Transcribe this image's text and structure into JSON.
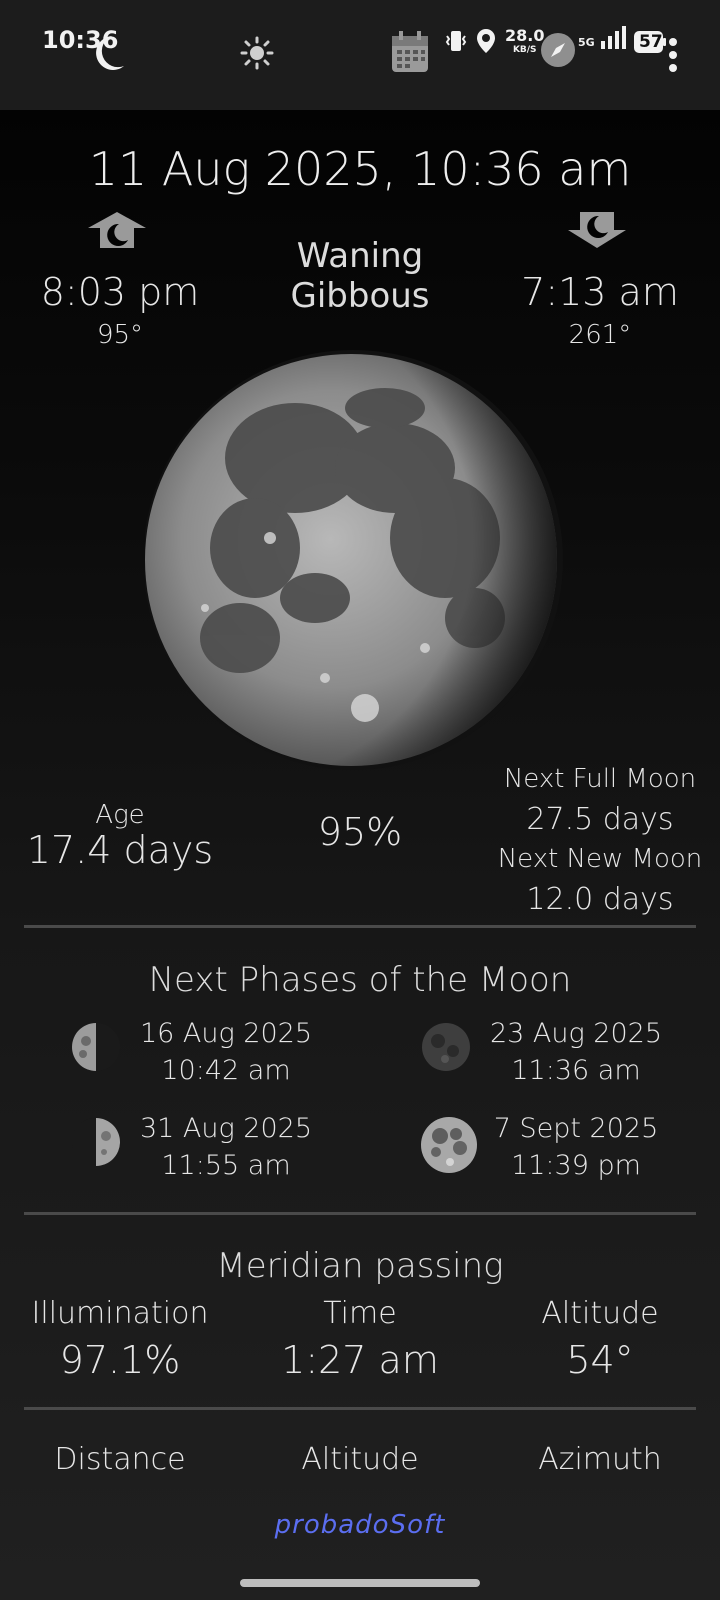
{
  "status_bar": {
    "time": "10:36",
    "speed_value": "28.0",
    "speed_unit": "KB/S",
    "network": "5G",
    "battery": "57",
    "icons": [
      "moon-icon",
      "sun-icon",
      "calendar-icon",
      "vibrate-icon",
      "location-icon",
      "compass-icon",
      "signal-icon",
      "battery-icon",
      "more-icon"
    ]
  },
  "header": {
    "datetime": "11 Aug 2025, 10:36 am",
    "moonrise_time": "8:03 pm",
    "moonrise_azimuth": "95°",
    "moonset_time": "7:13 am",
    "moonset_azimuth": "261°",
    "phase_line1": "Waning",
    "phase_line2": "Gibbous"
  },
  "stats": {
    "age_label": "Age",
    "age_value": "17.4 days",
    "illumination": "95%",
    "next_full_label": "Next Full Moon",
    "next_full_value": "27.5 days",
    "next_new_label": "Next New Moon",
    "next_new_value": "12.0 days"
  },
  "next_phases": {
    "title": "Next Phases of the Moon",
    "items": [
      {
        "date": "16 Aug 2025",
        "time": "10:42 am",
        "phase": "last-quarter"
      },
      {
        "date": "23 Aug 2025",
        "time": "11:36 am",
        "phase": "new"
      },
      {
        "date": "31 Aug 2025",
        "time": "11:55 am",
        "phase": "first-quarter"
      },
      {
        "date": "7 Sept 2025",
        "time": "11:39 pm",
        "phase": "full"
      }
    ]
  },
  "meridian": {
    "title": "Meridian passing",
    "illumination_label": "Illumination",
    "illumination_value": "97.1%",
    "time_label": "Time",
    "time_value": "1:27 am",
    "altitude_label": "Altitude",
    "altitude_value": "54°"
  },
  "footer": {
    "distance_label": "Distance",
    "altitude_label": "Altitude",
    "azimuth_label": "Azimuth",
    "brand": "probadoSoft"
  },
  "colors": {
    "background": "#141414",
    "text": "#e6e6e6",
    "divider": "#4a4a4a",
    "brand": "#5b6ef0"
  }
}
